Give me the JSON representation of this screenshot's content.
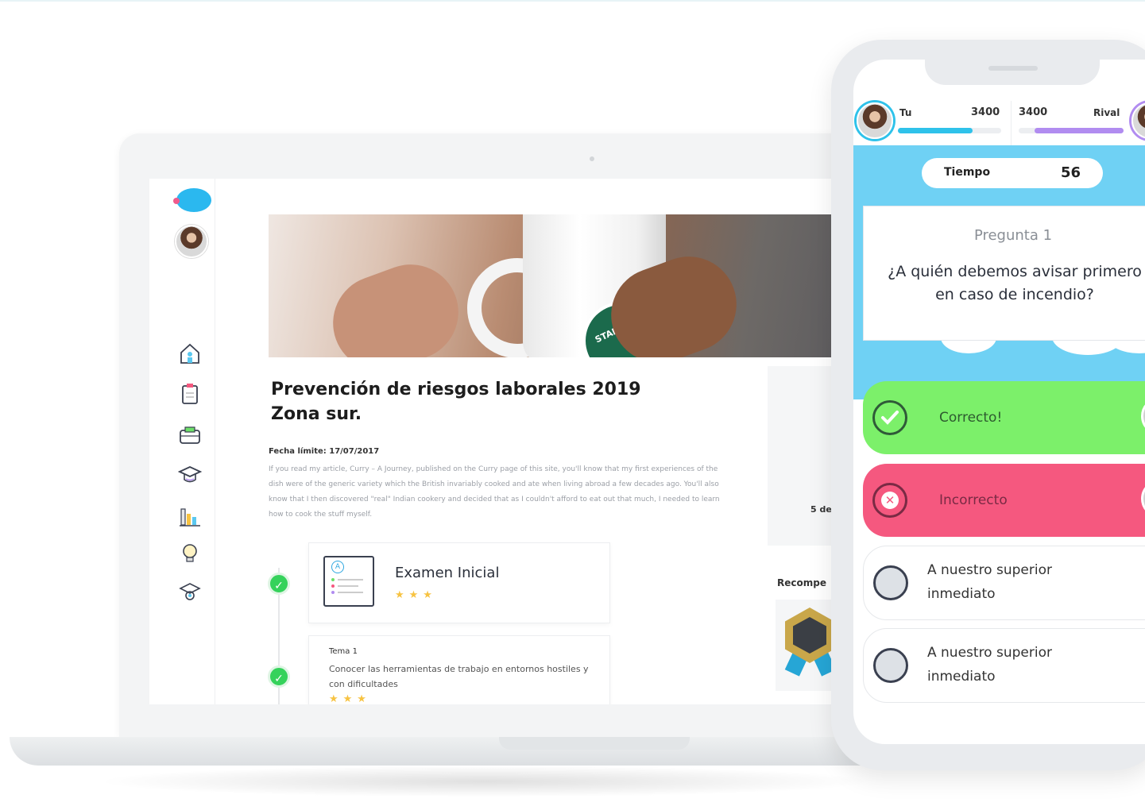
{
  "laptop": {
    "article": {
      "title_line1": "Prevención de riesgos laborales 2019",
      "title_line2": "Zona sur.",
      "deadline": "Fecha límite: 17/07/2017",
      "body": "If you read my article, Curry – A Journey, published on the Curry page of this site, you'll know that my first experiences of the dish were of the generic variety which the British invariably cooked and ate when living abroad a few decades ago. You'll also know that I then discovered \"real\" Indian cookery and decided that as I couldn't afford to eat out that much, I needed to learn how to cook the stuff myself."
    },
    "mug_text": "STARBUC",
    "exam_card": {
      "icon_letter": "A",
      "title": "Examen Inicial",
      "stars": "★★★"
    },
    "tema_card": {
      "label": "Tema 1",
      "text": "Conocer las herramientas de trabajo en entornos hostiles y con dificultades",
      "stars": "★★★"
    },
    "right_panel": {
      "partial_text": "5 de",
      "rewards_partial": "Recompe"
    },
    "sidebar": {
      "icons": [
        "home-icon",
        "clipboard-icon",
        "briefcase-icon",
        "graduation-cap-icon",
        "bar-chart-icon",
        "lightbulb-icon",
        "settings-hat-icon"
      ]
    }
  },
  "phone": {
    "player": {
      "name": "Tu",
      "score": "3400",
      "progress": 0.72
    },
    "rival": {
      "name": "Rival",
      "score": "3400",
      "progress": 0.85
    },
    "timer": {
      "label": "Tiempo",
      "value": "56"
    },
    "question": {
      "label": "Pregunta 1",
      "text": "¿A quién debemos avisar primero en caso de incendio?"
    },
    "answers": [
      {
        "text": "Correcto!",
        "state": "correct",
        "color": "#7cf06a"
      },
      {
        "text": "Incorrecto",
        "state": "incorrect",
        "color": "#f5587f"
      },
      {
        "line1": "A nuestro superior",
        "line2": "inmediato",
        "state": "neutral"
      },
      {
        "line1": "A nuestro superior",
        "line2": "inmediato",
        "state": "neutral"
      }
    ]
  },
  "colors": {
    "accent_blue": "#6fd1f4",
    "player_bar": "#2fc2ea",
    "rival_bar": "#b18cf0",
    "check_green": "#35d25b",
    "star": "#f7c342"
  }
}
